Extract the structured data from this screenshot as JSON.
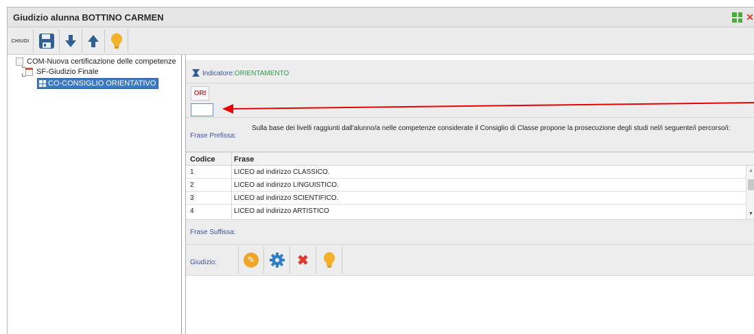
{
  "window": {
    "title": "Giudizio alunna BOTTINO CARMEN"
  },
  "toolbar": {
    "close_label": "CHIUDI",
    "buttons": [
      "save-icon",
      "arrow-down-icon",
      "arrow-up-icon",
      "lightbulb-icon"
    ]
  },
  "tree": {
    "items": [
      {
        "label": "COM-Nuova certificazione delle competenze",
        "level": 0
      },
      {
        "label": "SF-Giudizio Finale",
        "level": 1
      },
      {
        "label": "CO-CONSIGLIO ORIENTATIVO",
        "level": 2,
        "selected": true
      }
    ]
  },
  "indicatore": {
    "label": "Indicatore:",
    "value": "ORIENTAMENTO"
  },
  "ori": {
    "button_label": "ORI",
    "input_value": ""
  },
  "prefissa": {
    "label": "Frase Prefissa:",
    "text": "Sulla base dei livelli raggiunti dall'alunno/a nelle competenze considerate il Consiglio di Classe propone la prosecuzione degli studi nel/i seguente/i percorso/i:"
  },
  "table": {
    "headers": [
      "Codice",
      "Frase"
    ],
    "rows": [
      {
        "code": "1",
        "frase": "LICEO ad indirizzo CLASSICO."
      },
      {
        "code": "2",
        "frase": "LICEO ad indirizzo LINGUISTICO."
      },
      {
        "code": "3",
        "frase": "LICEO ad indirizzo SCIENTIFICO."
      },
      {
        "code": "4",
        "frase": "LICEO ad indirizzo ARTISTICO"
      }
    ]
  },
  "suffissa": {
    "label": "Frase Suffissa:"
  },
  "giudizio": {
    "label": "Giudizio:",
    "buttons": [
      "pencil-icon",
      "gear-icon",
      "delete-icon",
      "lightbulb-icon"
    ]
  },
  "colors": {
    "label_blue": "#3b52a8",
    "value_green": "#2e9b47",
    "selection_blue": "#3a78c9",
    "annotation_red": "#e60000"
  }
}
